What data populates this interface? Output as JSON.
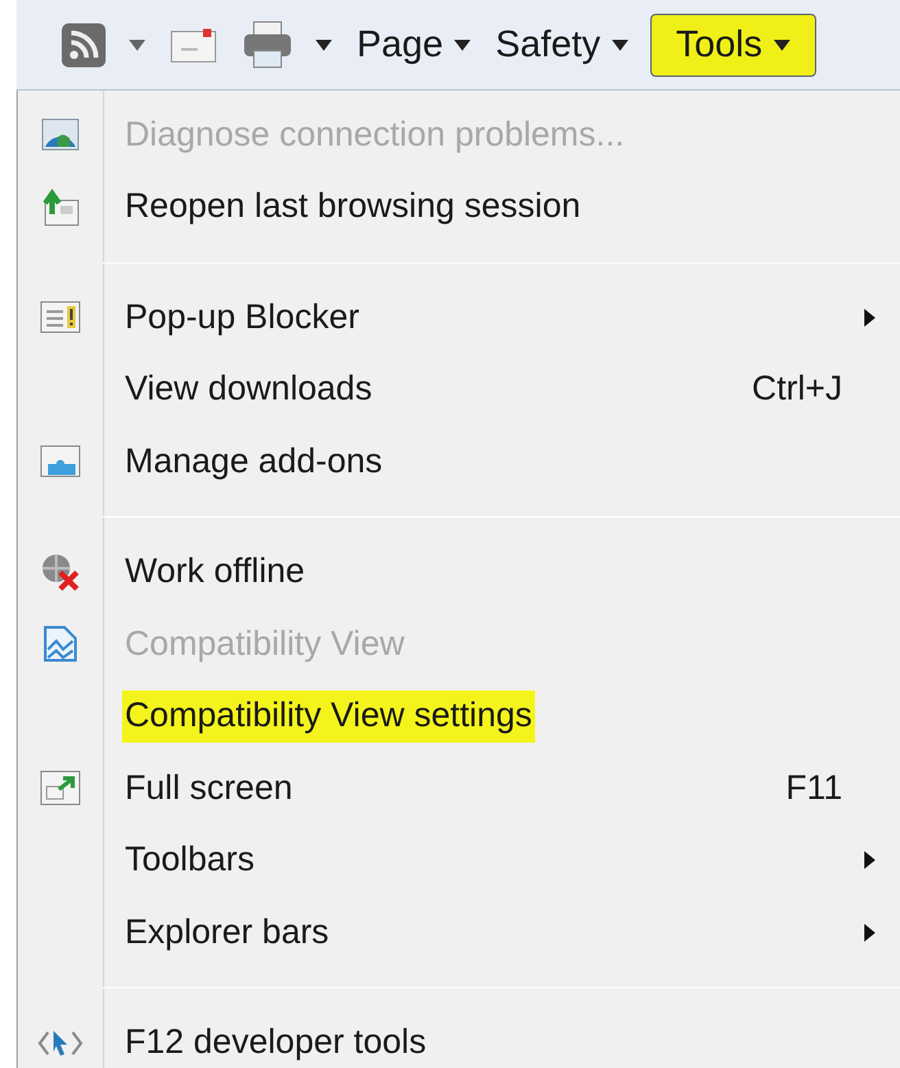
{
  "toolbar": {
    "buttons": [
      {
        "kind": "feeds",
        "dropdown": true
      },
      {
        "kind": "mail",
        "dropdown": false
      },
      {
        "kind": "print",
        "dropdown": true
      },
      {
        "kind": "menu",
        "label": "Page",
        "pressed": false,
        "highlighted": false
      },
      {
        "kind": "menu",
        "label": "Safety",
        "pressed": false,
        "highlighted": false
      },
      {
        "kind": "menu",
        "label": "Tools",
        "pressed": true,
        "highlighted": true
      }
    ]
  },
  "menu": {
    "items": [
      {
        "kind": "item",
        "label": "Diagnose connection problems...",
        "disabled": true,
        "highlighted": false,
        "submenu": false
      },
      {
        "kind": "item",
        "label": "Reopen last browsing session",
        "disabled": false,
        "highlighted": false,
        "submenu": false
      },
      {
        "kind": "separator"
      },
      {
        "kind": "item",
        "label": "Pop-up Blocker",
        "disabled": false,
        "highlighted": false,
        "submenu": true
      },
      {
        "kind": "item",
        "label": "View downloads",
        "shortcut": "Ctrl+J",
        "disabled": false,
        "highlighted": false,
        "submenu": false
      },
      {
        "kind": "item",
        "label": "Manage add-ons",
        "disabled": false,
        "highlighted": false,
        "submenu": false
      },
      {
        "kind": "separator"
      },
      {
        "kind": "item",
        "label": "Work offline",
        "disabled": false,
        "highlighted": false,
        "submenu": false
      },
      {
        "kind": "item",
        "label": "Compatibility View",
        "disabled": true,
        "highlighted": false,
        "submenu": false
      },
      {
        "kind": "item",
        "label": "Compatibility View settings",
        "disabled": false,
        "highlighted": true,
        "submenu": false
      },
      {
        "kind": "item",
        "label": "Full screen",
        "shortcut": "F11",
        "disabled": false,
        "highlighted": false,
        "submenu": false
      },
      {
        "kind": "item",
        "label": "Toolbars",
        "disabled": false,
        "highlighted": false,
        "submenu": true
      },
      {
        "kind": "item",
        "label": "Explorer bars",
        "disabled": false,
        "highlighted": false,
        "submenu": true
      },
      {
        "kind": "separator"
      },
      {
        "kind": "item",
        "label": "F12 developer tools",
        "disabled": false,
        "highlighted": false,
        "submenu": false
      }
    ]
  }
}
